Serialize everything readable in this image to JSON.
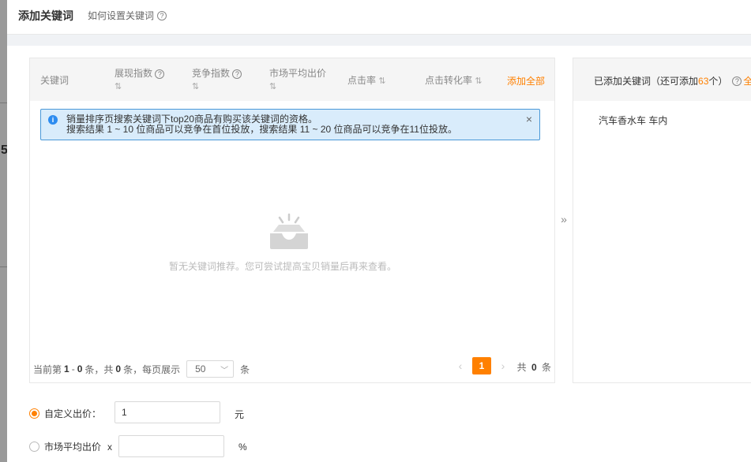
{
  "dialog": {
    "title": "添加关键词",
    "help_link": "如何设置关键词"
  },
  "table": {
    "headers": {
      "keyword": "关键词",
      "impression": "展现指数",
      "competition": "竞争指数",
      "avg_bid": "市场平均出价",
      "ctr": "点击率",
      "cvr": "点击转化率"
    },
    "sort_glyph": "⇅",
    "add_all": "添加全部"
  },
  "alert": {
    "line1": "销量排序页搜索关键词下top20商品有购买该关键词的资格。",
    "line2": "搜索结果 1 ~ 10 位商品可以竞争在首位投放，搜索结果 11 ~ 20 位商品可以竞争在11位投放。",
    "close": "×"
  },
  "empty": {
    "text": "暂无关键词推荐。您可尝试提高宝贝销量后再来查看。"
  },
  "pager": {
    "prefix": "当前第",
    "range_start": "1",
    "dash": "-",
    "range_end": "0",
    "unit1": "条，共",
    "total": "0",
    "unit2": "条，每页展示",
    "page_size": "50",
    "unit3": "条",
    "current_page": "1",
    "total_prefix": "共",
    "total_count": "0",
    "total_suffix": "条"
  },
  "transfer_arrow": "»",
  "added": {
    "header_prefix": "已添加关键词（还可添加",
    "remaining": "63",
    "header_suffix": "个）",
    "help_suffix": "全",
    "items": [
      "汽车香水车 车内"
    ]
  },
  "bid": {
    "custom_label": "自定义出价：",
    "custom_value": "1",
    "custom_unit": "元",
    "market_label": "市场平均出价",
    "market_mult": "x",
    "market_value": "",
    "market_unit": "%"
  },
  "colors": {
    "accent": "#ff8000",
    "info": "#2d8cf0",
    "alert_bg": "#d9ecfb"
  }
}
